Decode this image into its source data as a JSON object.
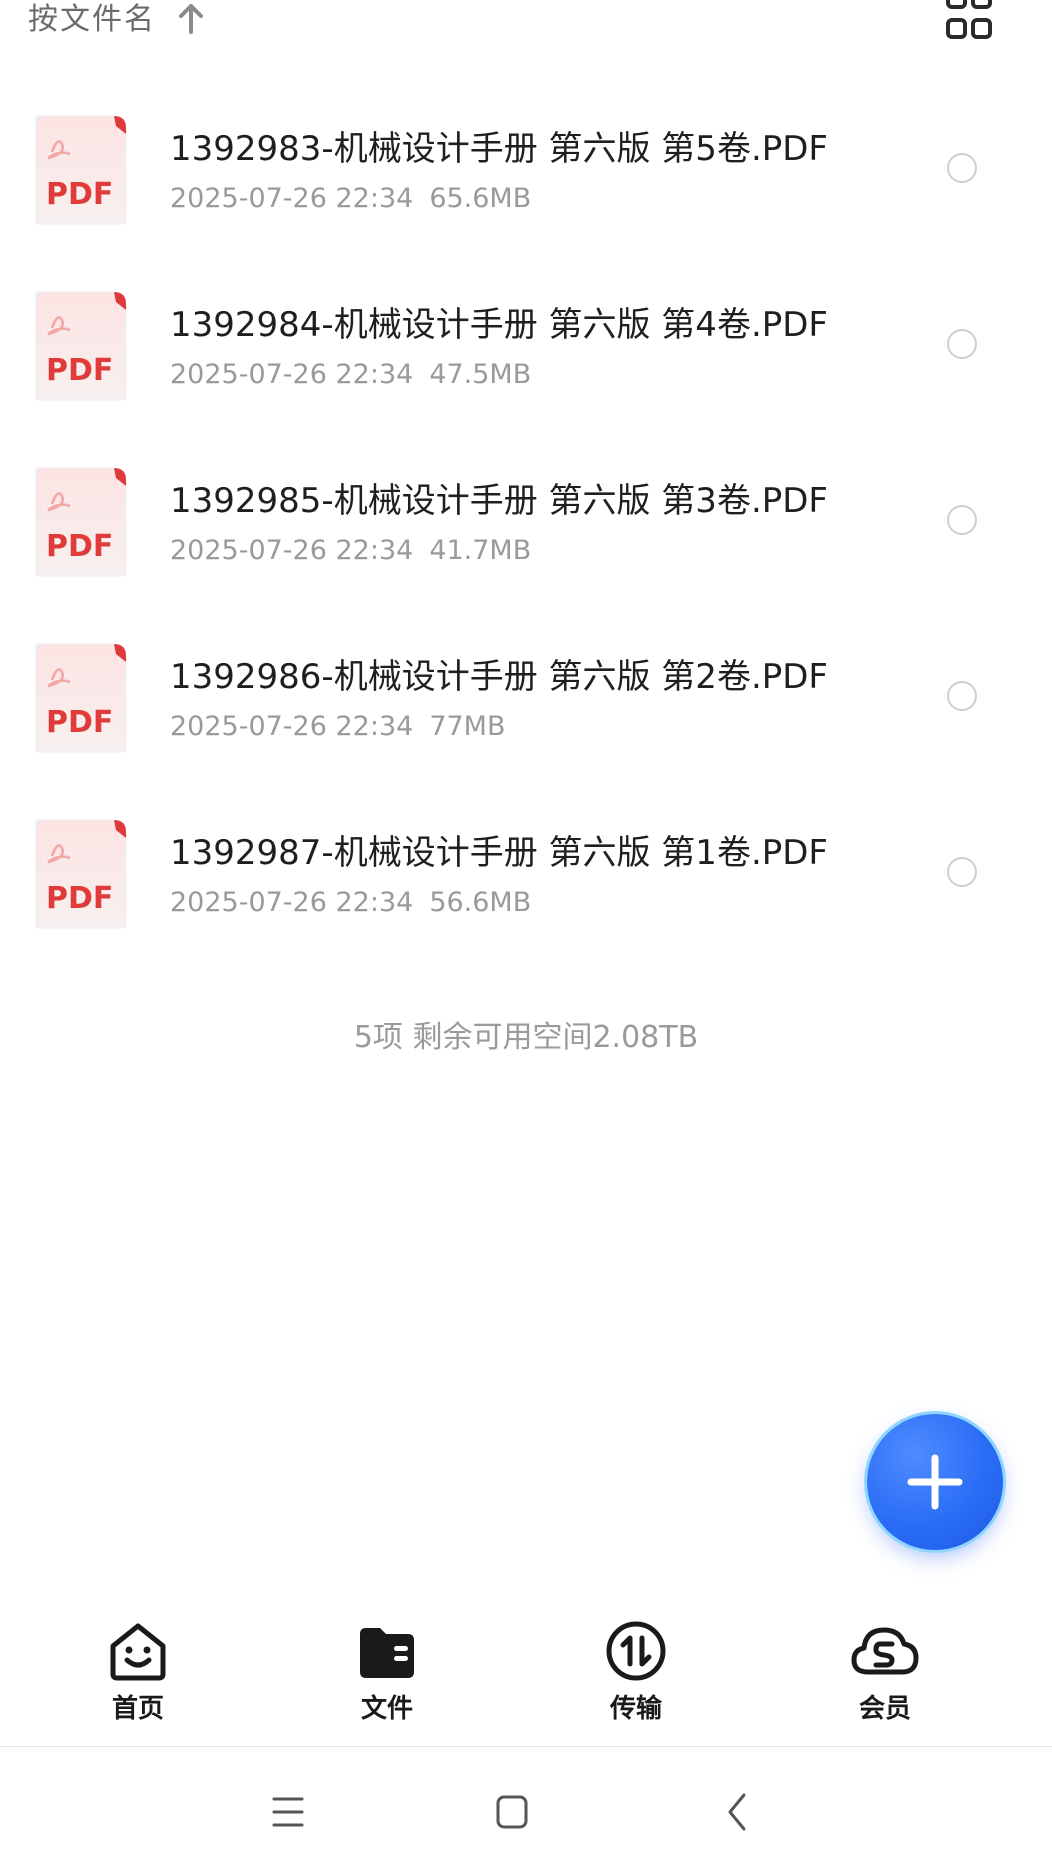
{
  "sort": {
    "label": "按文件名",
    "direction_icon": "arrow-up-icon"
  },
  "view_toggle_icon": "grid-view-icon",
  "files": [
    {
      "name": "1392983-机械设计手册 第六版 第5卷.PDF",
      "date": "2025-07-26 22:34",
      "size": "65.6MB",
      "icon_text": "PDF"
    },
    {
      "name": "1392984-机械设计手册 第六版 第4卷.PDF",
      "date": "2025-07-26 22:34",
      "size": "47.5MB",
      "icon_text": "PDF"
    },
    {
      "name": "1392985-机械设计手册 第六版 第3卷.PDF",
      "date": "2025-07-26 22:34",
      "size": "41.7MB",
      "icon_text": "PDF"
    },
    {
      "name": "1392986-机械设计手册 第六版 第2卷.PDF",
      "date": "2025-07-26 22:34",
      "size": "77MB",
      "icon_text": "PDF"
    },
    {
      "name": "1392987-机械设计手册 第六版 第1卷.PDF",
      "date": "2025-07-26 22:34",
      "size": "56.6MB",
      "icon_text": "PDF"
    }
  ],
  "summary": "5项 剩余可用空间2.08TB",
  "fab_icon": "plus-icon",
  "nav": [
    {
      "label": "首页",
      "icon": "home-smile-icon"
    },
    {
      "label": "文件",
      "icon": "folder-icon"
    },
    {
      "label": "传输",
      "icon": "transfer-icon"
    },
    {
      "label": "会员",
      "icon": "cloud-vip-icon"
    }
  ],
  "colors": {
    "accent": "#2a6df5",
    "pdf_red": "#e03b3b",
    "muted": "#9a9a9a"
  }
}
